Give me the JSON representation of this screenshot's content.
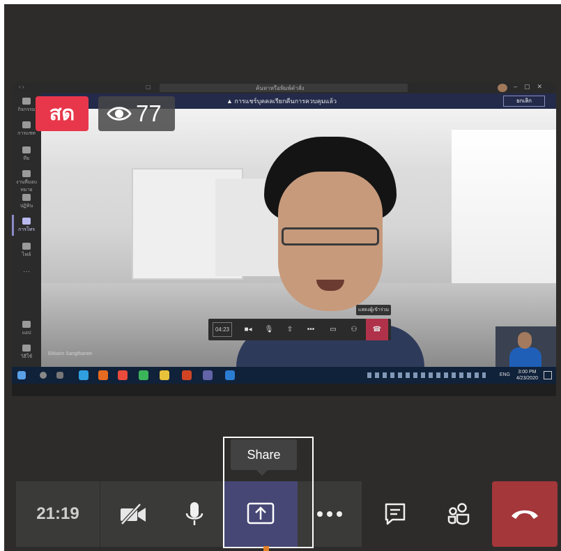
{
  "stream": {
    "live_label": "สด",
    "viewer_count": "77"
  },
  "shared_screen": {
    "titlebar_search": "ค้นหาหรือพิมพ์คำสั่ง",
    "banner_text": "การแชร์บุคคลเรียกคืนการควบคุมแล้ว",
    "banner_button": "ยกเลิก",
    "rail_items": [
      "กิจกรรม",
      "การแชท",
      "ทีม",
      "งานที่มอบหมาย",
      "ปฏิทิน",
      "การโทร",
      "ไฟล์",
      "แอป",
      "วิธีใช้"
    ],
    "inner_call_time": "04:23",
    "inner_tooltip": "แสดงผู้เข้าร่วม",
    "speaker_name": "Ekkarin Sangthanee",
    "taskbar_lang": "ENG",
    "taskbar_time": "3:00 PM",
    "taskbar_date": "4/23/2020"
  },
  "controls": {
    "call_duration": "21:19",
    "share_tooltip": "Share"
  },
  "colors": {
    "live": "#e8374b",
    "hangup": "#a4373a",
    "share_active": "#464775",
    "bar": "#3a3a39"
  }
}
